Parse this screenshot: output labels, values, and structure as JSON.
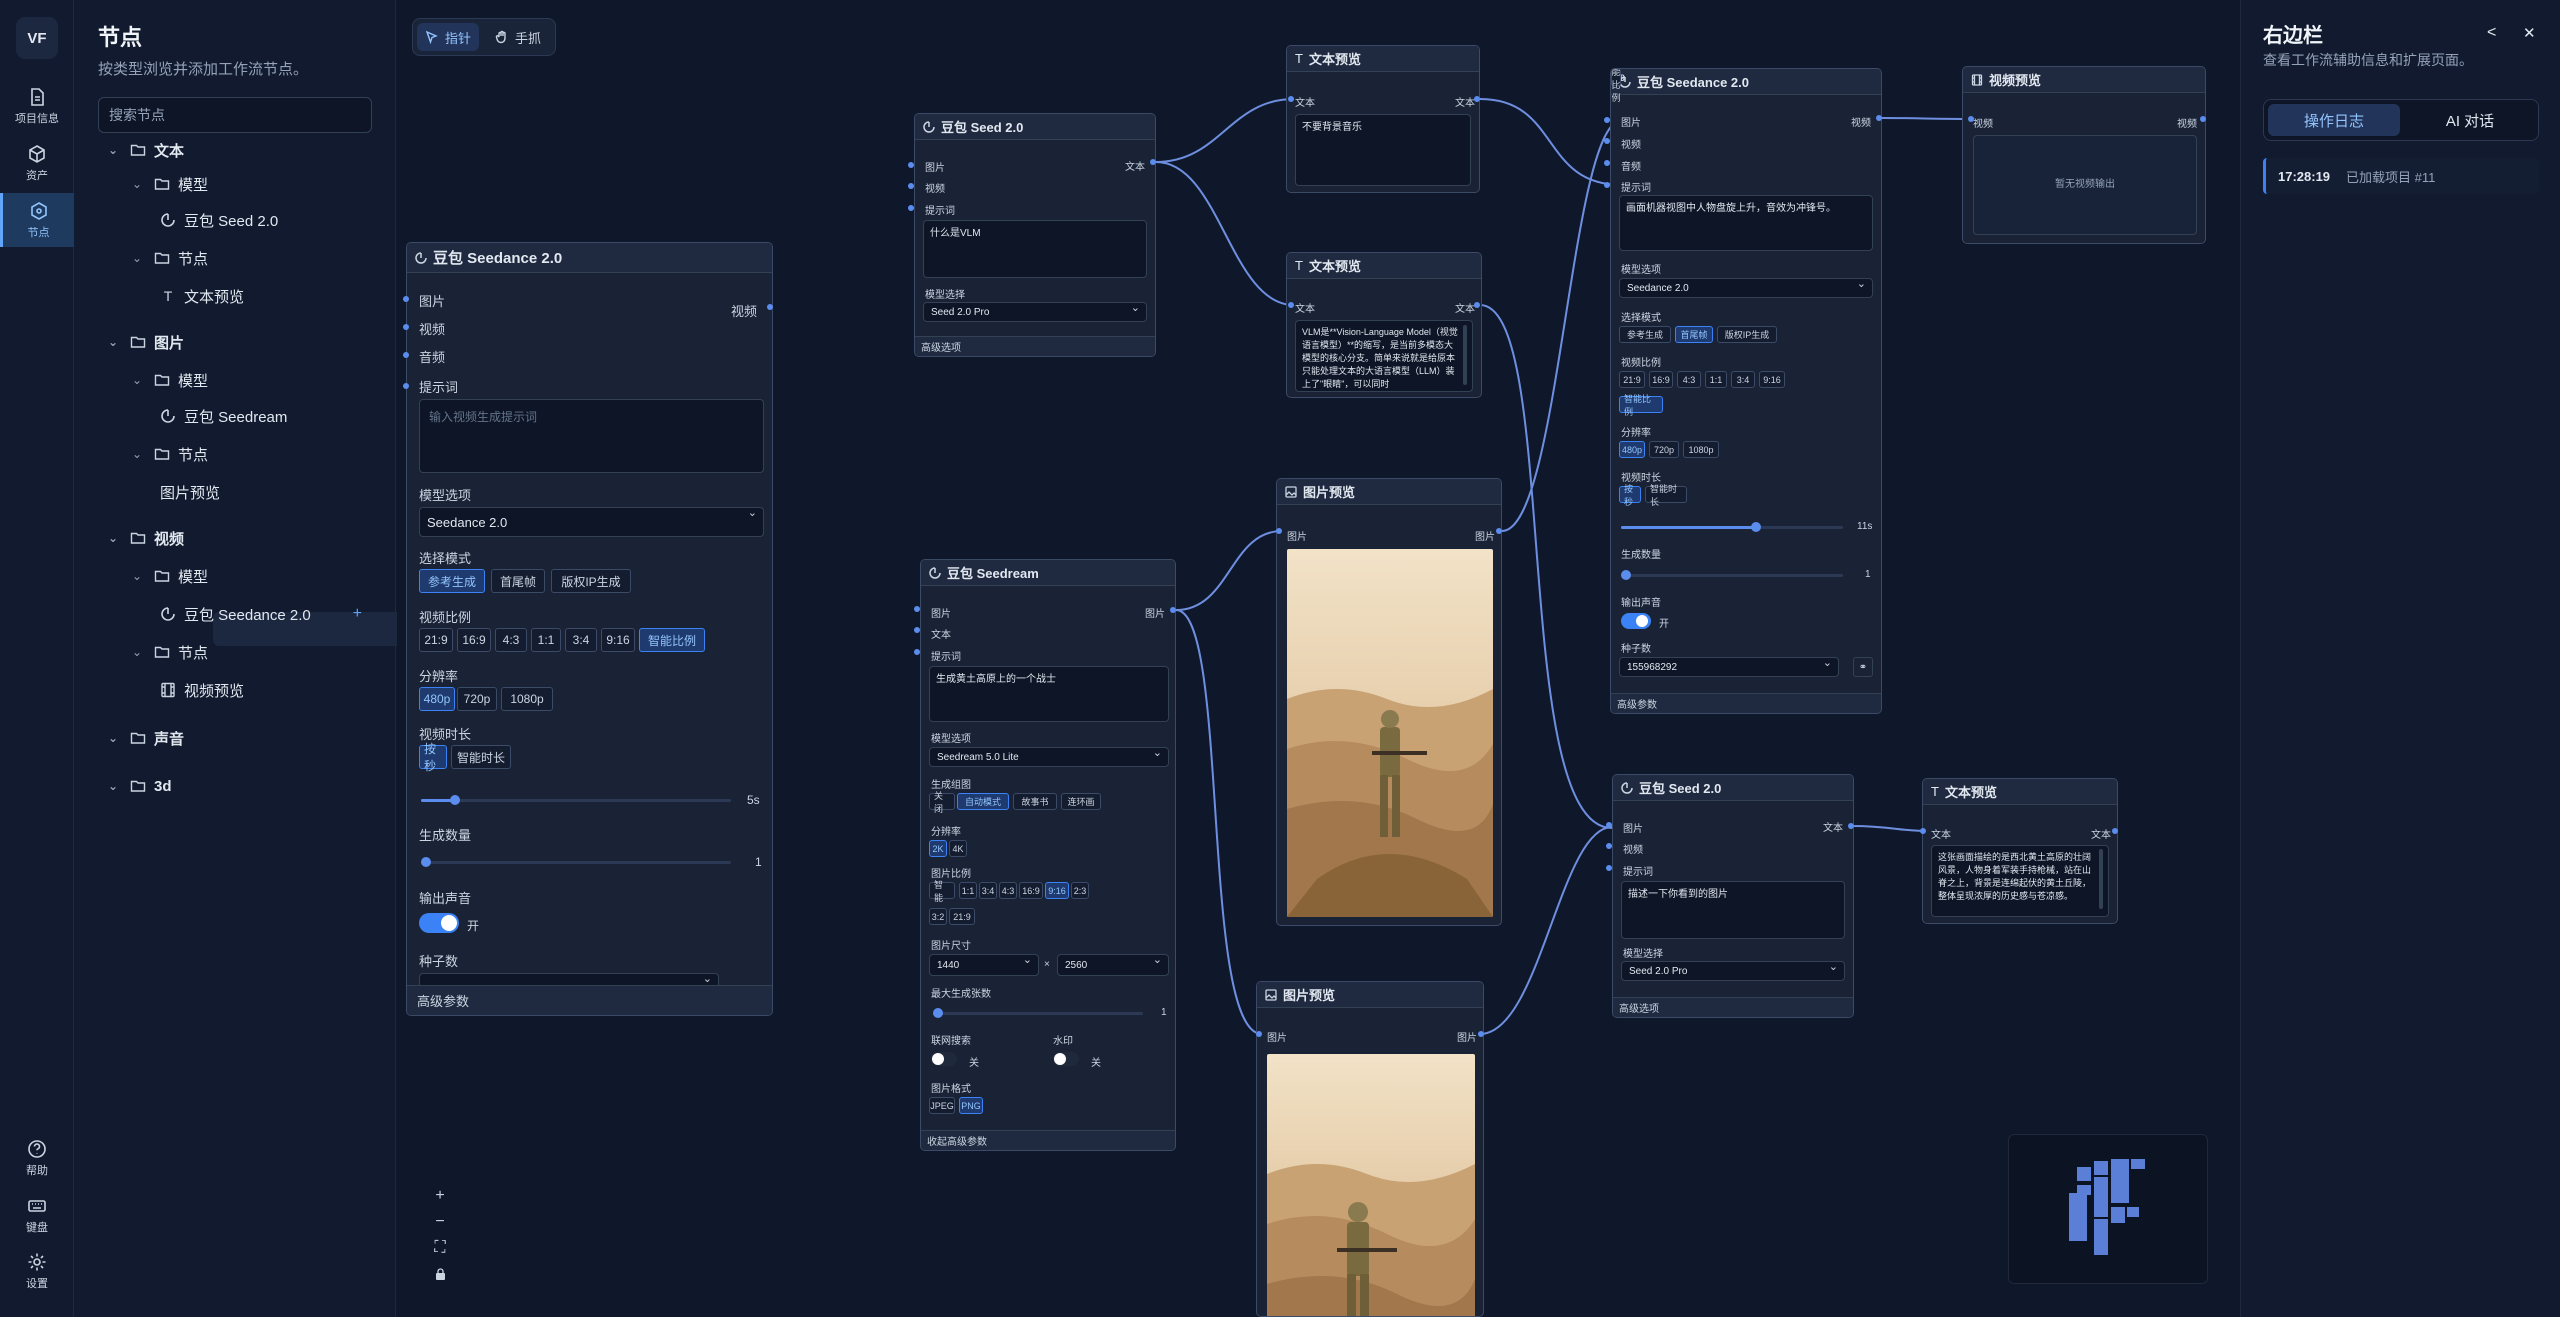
{
  "rail": {
    "logo": "VF",
    "items": [
      {
        "label": "项目信息",
        "icon": "document-icon"
      },
      {
        "label": "资产",
        "icon": "cube-icon"
      },
      {
        "label": "节点",
        "icon": "nodes-icon"
      }
    ],
    "bottom": [
      {
        "label": "帮助",
        "icon": "help-icon"
      },
      {
        "label": "键盘",
        "icon": "keyboard-icon"
      },
      {
        "label": "设置",
        "icon": "gear-icon"
      }
    ]
  },
  "library": {
    "title": "节点",
    "subtitle": "按类型浏览并添加工作流节点。",
    "search_placeholder": "搜索节点",
    "tree": [
      {
        "label": "文本",
        "depth": 0,
        "type": "folder"
      },
      {
        "label": "模型",
        "depth": 1,
        "type": "folder"
      },
      {
        "label": "豆包 Seed 2.0",
        "depth": 2,
        "type": "model"
      },
      {
        "label": "节点",
        "depth": 1,
        "type": "folder"
      },
      {
        "label": "文本预览",
        "depth": 2,
        "type": "text"
      },
      {
        "label": "图片",
        "depth": 0,
        "type": "folder"
      },
      {
        "label": "模型",
        "depth": 1,
        "type": "folder"
      },
      {
        "label": "豆包 Seedream",
        "depth": 2,
        "type": "model"
      },
      {
        "label": "节点",
        "depth": 1,
        "type": "folder"
      },
      {
        "label": "图片预览",
        "depth": 2,
        "type": "plain"
      },
      {
        "label": "视频",
        "depth": 0,
        "type": "folder"
      },
      {
        "label": "模型",
        "depth": 1,
        "type": "folder"
      },
      {
        "label": "豆包 Seedance 2.0",
        "depth": 2,
        "type": "model",
        "add": "+"
      },
      {
        "label": "节点",
        "depth": 1,
        "type": "folder"
      },
      {
        "label": "视频预览",
        "depth": 2,
        "type": "video"
      },
      {
        "label": "声音",
        "depth": 0,
        "type": "folder"
      },
      {
        "label": "3d",
        "depth": 0,
        "type": "folder"
      }
    ]
  },
  "toolbar": {
    "pointer": "指针",
    "hand": "手抓"
  },
  "node_big": {
    "title": "豆包 Seedance 2.0",
    "in_image": "图片",
    "in_video": "视频",
    "in_audio": "音频",
    "out_video": "视频",
    "prompt_label": "提示词",
    "prompt_placeholder": "输入视频生成提示词",
    "model_label": "模型选项",
    "model_value": "Seedance 2.0",
    "mode_label": "选择模式",
    "modes": [
      "参考生成",
      "首尾帧",
      "版权IP生成"
    ],
    "ratio_label": "视频比例",
    "ratios": [
      "21:9",
      "16:9",
      "4:3",
      "1:1",
      "3:4",
      "9:16",
      "智能比例"
    ],
    "res_label": "分辨率",
    "resolutions": [
      "480p",
      "720p",
      "1080p"
    ],
    "dur_label": "视频时长",
    "durations": [
      "按秒",
      "智能时长"
    ],
    "dur_value": "5s",
    "dur_fraction": 0.11,
    "count_label": "生成数量",
    "count_value": "1",
    "audio_label": "输出声音",
    "audio_state": "开",
    "seed_label": "种子数",
    "footer": "高级参数"
  },
  "node_seed1": {
    "title": "豆包 Seed 2.0",
    "in_image": "图片",
    "in_video": "视频",
    "in_prompt": "提示词",
    "out_text": "文本",
    "prompt": "什么是VLM",
    "model_label": "模型选择",
    "model_value": "Seed 2.0 Pro",
    "footer": "高级选项"
  },
  "node_tp1": {
    "title": "文本预览",
    "in": "文本",
    "out": "文本",
    "content": "不要背景音乐"
  },
  "node_tp2": {
    "title": "文本预览",
    "in": "文本",
    "out": "文本",
    "content": "VLM是**Vision-Language Model（视觉语言模型）**的缩写，是当前多模态大模型的核心分支。简单来说就是给原本只能处理文本的大语言模型（LLM）装上了\"眼睛\"，可以同时"
  },
  "node_sd": {
    "title": "豆包 Seedream",
    "in_image": "图片",
    "in_text": "文本",
    "in_prompt": "提示词",
    "out_image": "图片",
    "prompt": "生成黄土高原上的一个战士",
    "model_label": "模型选项",
    "model_value": "Seedream 5.0 Lite",
    "group_label": "生成组图",
    "groups": [
      "关闭",
      "自动模式",
      "故事书",
      "连环画"
    ],
    "res_label": "分辨率",
    "resolutions": [
      "2K",
      "4K"
    ],
    "ratio_label": "图片比例",
    "ratios": [
      "智能",
      "1:1",
      "3:4",
      "4:3",
      "16:9",
      "9:16",
      "2:3",
      "3:2",
      "21:9"
    ],
    "size_label": "图片尺寸",
    "width": "1440",
    "x_sign": "×",
    "height": "2560",
    "max_label": "最大生成张数",
    "max_value": "1",
    "web_label": "联网搜索",
    "web_state": "关",
    "wm_label": "水印",
    "wm_state": "关",
    "fmt_label": "图片格式",
    "formats": [
      "JPEG",
      "PNG"
    ],
    "footer": "收起高级参数"
  },
  "node_ip1": {
    "title": "图片预览",
    "in": "图片",
    "out": "图片"
  },
  "node_ip2": {
    "title": "图片预览",
    "in": "图片",
    "out": "图片"
  },
  "node_vid": {
    "title": "豆包 Seedance 2.0",
    "in_image": "图片",
    "in_video": "视频",
    "in_audio": "音频",
    "out_video": "视频",
    "prompt_label": "提示词",
    "prompt": "画面机器视图中人物盘旋上升，音效为冲锋号。",
    "model_label": "模型选项",
    "model_value": "Seedance 2.0",
    "mode_label": "选择模式",
    "modes": [
      "参考生成",
      "首尾帧",
      "版权IP生成"
    ],
    "ratio_label": "视频比例",
    "ratios": [
      "21:9",
      "16:9",
      "4:3",
      "1:1",
      "3:4",
      "9:16",
      "智能比例"
    ],
    "res_label": "分辨率",
    "resolutions": [
      "480p",
      "720p",
      "1080p"
    ],
    "dur_label": "视频时长",
    "durations": [
      "按秒",
      "智能时长"
    ],
    "dur_value": "11s",
    "dur_fraction": 0.61,
    "count_label": "生成数量",
    "count_value": "1",
    "audio_label": "输出声音",
    "audio_state": "开",
    "seed_label": "种子数",
    "seed_value": "155968292",
    "footer": "高级参数"
  },
  "node_vp": {
    "title": "视频预览",
    "in": "视频",
    "out": "视频",
    "empty": "暂无视频输出"
  },
  "node_seed2": {
    "title": "豆包 Seed 2.0",
    "in_image": "图片",
    "in_video": "视频",
    "in_prompt": "提示词",
    "out_text": "文本",
    "prompt": "描述一下你看到的图片",
    "model_label": "模型选择",
    "model_value": "Seed 2.0 Pro",
    "footer": "高级选项"
  },
  "node_tp3": {
    "title": "文本预览",
    "in": "文本",
    "out": "文本",
    "content": "这张画面描绘的是西北黄土高原的壮阔风景，人物身着军装手持枪械，站在山脊之上，背景是连绵起伏的黄土丘陵，整体呈现浓厚的历史感与苍凉感。"
  },
  "rightbar": {
    "title": "右边栏",
    "subtitle": "查看工作流辅助信息和扩展页面。",
    "tabs": [
      "操作日志",
      "AI 对话"
    ],
    "log_time": "17:28:19",
    "log_text": "已加载项目 #11"
  },
  "colors": {
    "accent": "#3b82f6",
    "port": "#5b8def",
    "edge": "#6e8fe0",
    "bg": "#0f172a",
    "panel": "#111a2e"
  }
}
